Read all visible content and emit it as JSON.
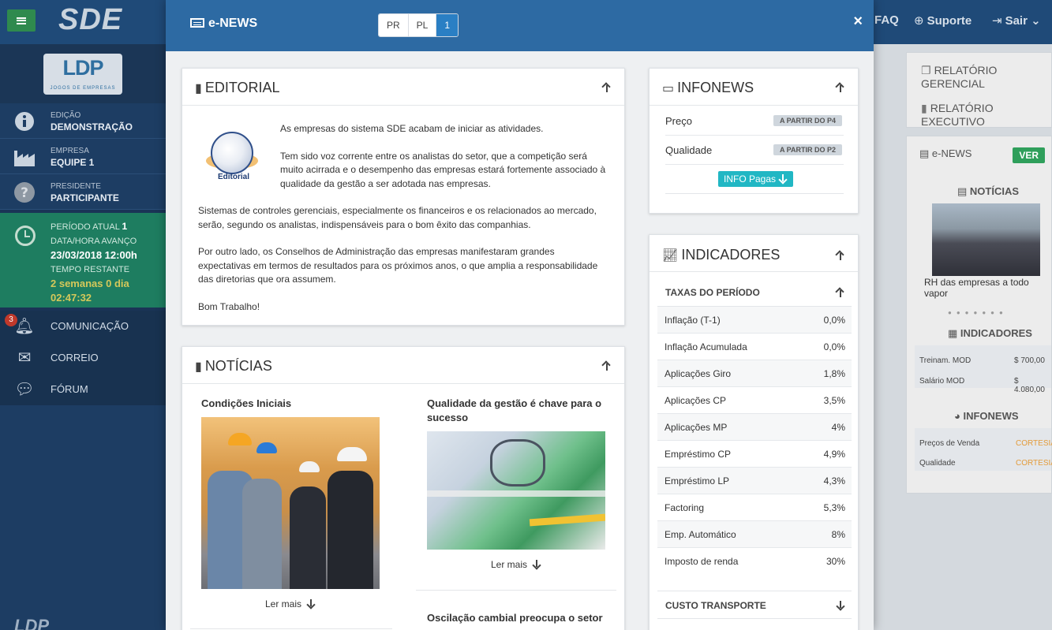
{
  "app": {
    "brand": "SDE",
    "topnav": {
      "faq": "FAQ",
      "support": "Suporte",
      "exit": "Sair"
    }
  },
  "sidebar": {
    "logo_text": "LDP",
    "logo_sub": "JOGOS DE EMPRESAS",
    "edition_label": "Edição",
    "edition_value": "DEMONSTRAÇÃO",
    "company_label": "Empresa",
    "company_value": "EQUIPE 1",
    "president_label": "Presidente",
    "president_value": "PARTICIPANTE",
    "period_label": "Período atual",
    "period_value": "1",
    "advance_label": "Data/hora avanço",
    "advance_value": "23/03/2018 12:00h",
    "remaining_label": "Tempo restante",
    "remaining_value_1": "2 semanas 0 dia",
    "remaining_value_2": "02:47:32",
    "nav": [
      {
        "label": "Comunicação",
        "badge": "3"
      },
      {
        "label": "Correio"
      },
      {
        "label": "Fórum"
      }
    ],
    "footer": "LDP"
  },
  "bg_right": {
    "reports": [
      "RELATÓRIO GERENCIAL",
      "RELATÓRIO EXECUTIVO"
    ],
    "enews": "e-NEWS",
    "ver": "VER",
    "noticias": "NOTÍCIAS",
    "caption": "RH das empresas a todo vapor",
    "indicadores": "INDICADORES",
    "ind_rows": [
      {
        "k": "Treinam. MOD",
        "v": "$ 700,00"
      },
      {
        "k": "Salário MOD",
        "v": "$ 4.080,00"
      }
    ],
    "infonews": "INFONEWS",
    "info_rows": [
      {
        "k": "Preços de Venda",
        "v": "CORTESIA"
      },
      {
        "k": "Qualidade",
        "v": "CORTESIA"
      }
    ]
  },
  "modal": {
    "title": "e-NEWS",
    "segments": [
      "PR",
      "PL",
      "1"
    ],
    "close": "×"
  },
  "editorial": {
    "title": "EDITORIAL",
    "logo_label": "Editorial",
    "p1": "As empresas do sistema SDE acabam de iniciar as atividades.",
    "p2": "Tem sido voz corrente entre os analistas do setor, que a competição será muito acirrada e o desempenho das empresas estará fortemente associado à qualidade da gestão a ser adotada nas empresas.",
    "p3": "Sistemas de controles gerenciais, especialmente os financeiros e os relacionados ao mercado, serão, segundo os analistas, indispensáveis para o bom êxito das companhias.",
    "p4": "Por outro lado, os Conselhos de Administração das empresas manifestaram grandes expectativas em termos de resultados para os próximos anos, o que amplia a responsabilidade das diretorias que ora assumem.",
    "p5": "Bom Trabalho!"
  },
  "noticias": {
    "title": "NOTÍCIAS",
    "items": [
      {
        "title": "Condições Iniciais",
        "more": "Ler mais"
      },
      {
        "title": "Qualidade da gestão é chave para o sucesso",
        "more": "Ler mais"
      },
      {
        "title": "Oscilação cambial preocupa o setor"
      }
    ]
  },
  "infonews": {
    "title": "INFONEWS",
    "rows": [
      {
        "label": "Preço",
        "badge": "A PARTIR DO P4"
      },
      {
        "label": "Qualidade",
        "badge": "A PARTIR DO P2"
      }
    ],
    "button": "INFO Pagas"
  },
  "indicadores": {
    "title": "INDICADORES",
    "section1": "TAXAS DO PERÍODO",
    "rows": [
      {
        "label": "Inflação (T-1)",
        "value": "0,0%"
      },
      {
        "label": "Inflação Acumulada",
        "value": "0,0%"
      },
      {
        "label": "Aplicações Giro",
        "value": "1,8%"
      },
      {
        "label": "Aplicações CP",
        "value": "3,5%"
      },
      {
        "label": "Aplicações MP",
        "value": "4%"
      },
      {
        "label": "Empréstimo CP",
        "value": "4,9%"
      },
      {
        "label": "Empréstimo LP",
        "value": "4,3%"
      },
      {
        "label": "Factoring",
        "value": "5,3%"
      },
      {
        "label": "Emp. Automático",
        "value": "8%"
      },
      {
        "label": "Imposto de renda",
        "value": "30%"
      }
    ],
    "section2": "CUSTO TRANSPORTE"
  }
}
